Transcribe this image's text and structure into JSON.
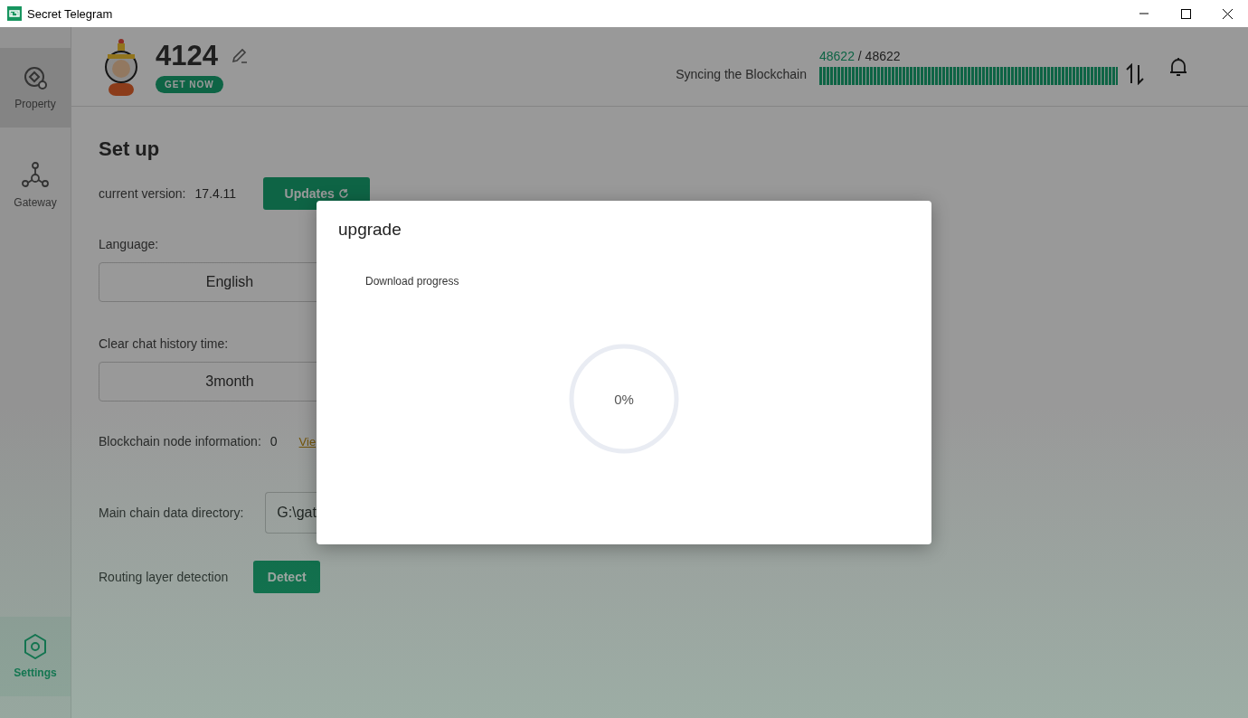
{
  "window": {
    "title": "Secret Telegram"
  },
  "sidebar": {
    "items": [
      {
        "label": "Property",
        "selected": false,
        "hovered": true
      },
      {
        "label": "Gateway",
        "selected": false,
        "hovered": false
      },
      {
        "label": "Settings",
        "selected": true,
        "hovered": false
      }
    ]
  },
  "header": {
    "name": "4124",
    "badge": "GET NOW",
    "sync": {
      "current": "48622",
      "separator": "/",
      "total": "48622",
      "label": "Syncing the Blockchain",
      "level": 1
    }
  },
  "settings": {
    "title": "Set up",
    "rows": [
      {
        "kind": "version",
        "label": "current version:",
        "value": "17.4.11",
        "button": "Updates"
      },
      {
        "kind": "select",
        "label": "Language:",
        "value": "English"
      },
      {
        "kind": "select",
        "label": "Clear chat history time:",
        "value": "3month"
      },
      {
        "kind": "info",
        "label": "Blockchain node information:",
        "value": "0",
        "link": "Vie"
      },
      {
        "kind": "directory",
        "label": "Main chain data directory:",
        "value": "G:\\gat"
      },
      {
        "kind": "action",
        "label": "Routing layer detection",
        "button": "Detect"
      }
    ]
  },
  "dialog": {
    "title": "upgrade",
    "caption": "Download progress",
    "progress": {
      "text": "0%",
      "level": 0
    }
  }
}
